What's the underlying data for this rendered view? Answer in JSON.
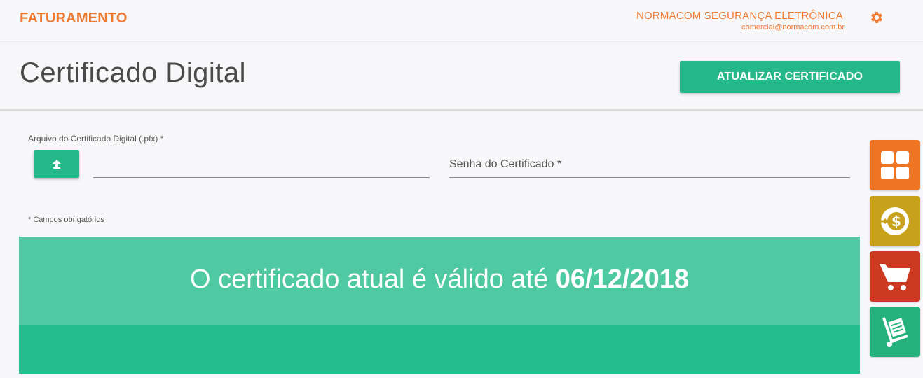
{
  "header": {
    "brand": "FATURAMENTO",
    "company_name": "NORMACOM SEGURANÇA ELETRÔNICA",
    "company_email": "comercial@normacom.com.br",
    "settings_icon": "gear-icon"
  },
  "page": {
    "title": "Certificado Digital",
    "update_button": "ATUALIZAR CERTIFICADO"
  },
  "form": {
    "file_label": "Arquivo do Certificado Digital (.pfx) *",
    "upload_icon": "upload-icon",
    "file_value": "",
    "password_placeholder": "Senha do Certificado *",
    "password_value": "",
    "required_note": "* Campos obrigatórios"
  },
  "banner": {
    "text_prefix": "O certificado atual é válido até ",
    "date": "06/12/2018"
  },
  "side_menu": [
    {
      "icon": "dashboard-grid-icon",
      "color": "#f07522"
    },
    {
      "icon": "money-icon",
      "color": "#c8a21a"
    },
    {
      "icon": "cart-icon",
      "color": "#cc3a22"
    },
    {
      "icon": "delivery-icon",
      "color": "#24b27c"
    }
  ],
  "colors": {
    "accent_orange": "#ee7a31",
    "primary_green": "#25b98a",
    "banner_green": "#4fc9a1"
  }
}
